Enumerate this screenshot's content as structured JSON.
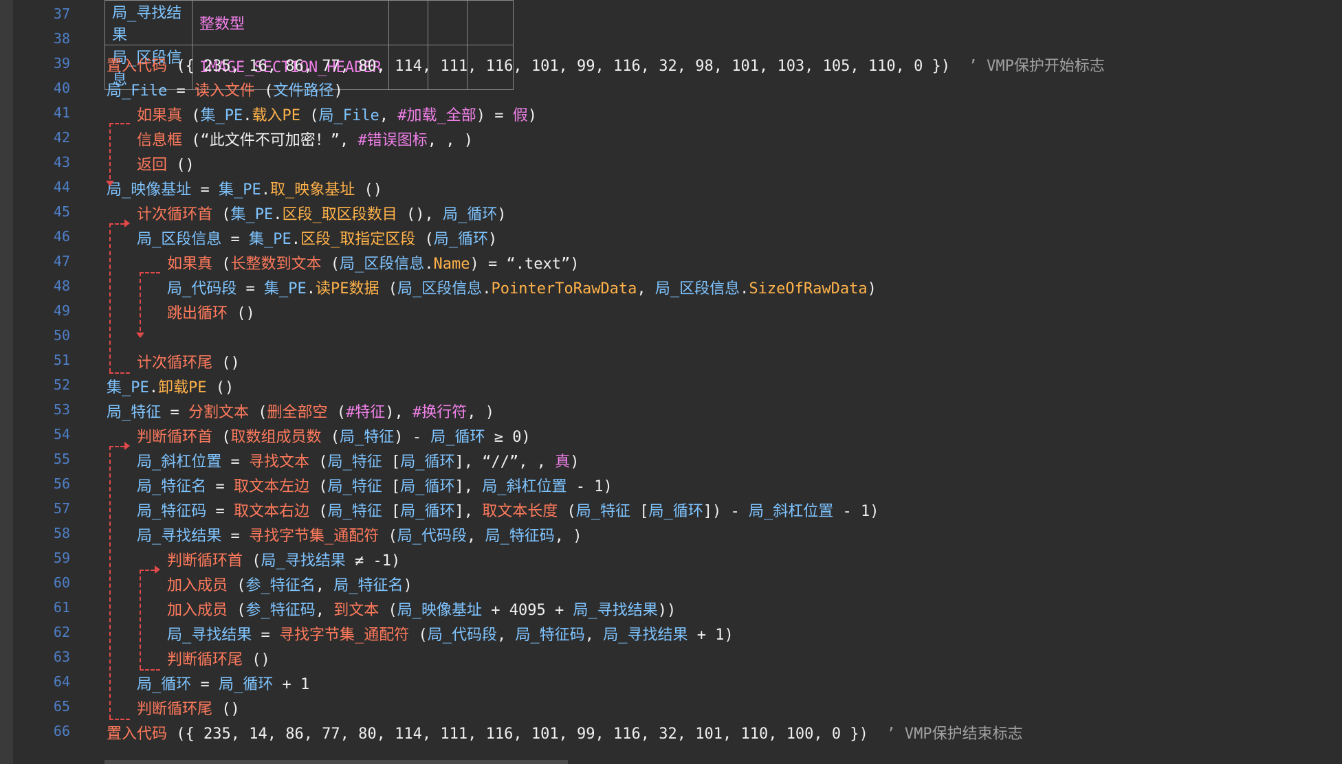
{
  "table": {
    "rows": [
      {
        "name": "局_寻找结果",
        "type": "整数型"
      },
      {
        "name": "局_区段信息",
        "type": "IMAGE_SECTION_HEADER"
      }
    ]
  },
  "lines": [
    {
      "n": "37"
    },
    {
      "n": "38"
    },
    {
      "n": "39",
      "tokens": [
        [
          "t-cmd",
          "置入代码"
        ],
        [
          "t-paren",
          " ({ "
        ],
        [
          "t-num",
          "235, 16, 86, 77, 80, 114, 111, 116, 101, 99, 116, 32, 98, 101, 103, 105, 110, 0"
        ],
        [
          "t-paren",
          " })  "
        ],
        [
          "t-cmt",
          "’ VMP保护开始标志"
        ]
      ]
    },
    {
      "n": "40",
      "tokens": [
        [
          "t-local",
          "局_File"
        ],
        [
          "t-op",
          " = "
        ],
        [
          "t-cmd",
          "读入文件"
        ],
        [
          "t-paren",
          " ("
        ],
        [
          "t-local",
          "文件路径"
        ],
        [
          "t-paren",
          ")"
        ]
      ]
    },
    {
      "n": "41",
      "tokens": [
        [
          "t-flow",
          "如果真"
        ],
        [
          "t-paren",
          " ("
        ],
        [
          "t-glob",
          "集_PE"
        ],
        [
          "t-op",
          "."
        ],
        [
          "t-field",
          "载入PE"
        ],
        [
          "t-paren",
          " ("
        ],
        [
          "t-local",
          "局_File"
        ],
        [
          "t-paren",
          ", "
        ],
        [
          "t-const",
          "#加载_全部"
        ],
        [
          "t-paren",
          ")"
        ],
        [
          "t-op",
          " = "
        ],
        [
          "t-kw",
          "假"
        ],
        [
          "t-paren",
          ")"
        ]
      ]
    },
    {
      "n": "42",
      "tokens": [
        [
          "t-cmd",
          "信息框"
        ],
        [
          "t-paren",
          " ("
        ],
        [
          "t-str",
          "“此文件不可加密！”"
        ],
        [
          "t-paren",
          ", "
        ],
        [
          "t-const",
          "#错误图标"
        ],
        [
          "t-paren",
          ", , )"
        ]
      ]
    },
    {
      "n": "43",
      "tokens": [
        [
          "t-flow",
          "返回"
        ],
        [
          "t-paren",
          " ()"
        ]
      ]
    },
    {
      "n": "44",
      "tokens": [
        [
          "t-local",
          "局_映像基址"
        ],
        [
          "t-op",
          " = "
        ],
        [
          "t-glob",
          "集_PE"
        ],
        [
          "t-op",
          "."
        ],
        [
          "t-field",
          "取_映象基址"
        ],
        [
          "t-paren",
          " ()"
        ]
      ]
    },
    {
      "n": "45",
      "tokens": [
        [
          "t-flow",
          "计次循环首"
        ],
        [
          "t-paren",
          " ("
        ],
        [
          "t-glob",
          "集_PE"
        ],
        [
          "t-op",
          "."
        ],
        [
          "t-field",
          "区段_取区段数目"
        ],
        [
          "t-paren",
          " (), "
        ],
        [
          "t-local",
          "局_循环"
        ],
        [
          "t-paren",
          ")"
        ]
      ]
    },
    {
      "n": "46",
      "tokens": [
        [
          "t-local",
          "局_区段信息"
        ],
        [
          "t-op",
          " = "
        ],
        [
          "t-glob",
          "集_PE"
        ],
        [
          "t-op",
          "."
        ],
        [
          "t-field",
          "区段_取指定区段"
        ],
        [
          "t-paren",
          " ("
        ],
        [
          "t-local",
          "局_循环"
        ],
        [
          "t-paren",
          ")"
        ]
      ]
    },
    {
      "n": "47",
      "tokens": [
        [
          "t-flow",
          "如果真"
        ],
        [
          "t-paren",
          " ("
        ],
        [
          "t-cmd",
          "长整数到文本"
        ],
        [
          "t-paren",
          " ("
        ],
        [
          "t-local",
          "局_区段信息"
        ],
        [
          "t-op",
          "."
        ],
        [
          "t-field",
          "Name"
        ],
        [
          "t-paren",
          ")"
        ],
        [
          "t-op",
          " = "
        ],
        [
          "t-str",
          "“.text”"
        ],
        [
          "t-paren",
          ")"
        ]
      ]
    },
    {
      "n": "48",
      "tokens": [
        [
          "t-local",
          "局_代码段"
        ],
        [
          "t-op",
          " = "
        ],
        [
          "t-glob",
          "集_PE"
        ],
        [
          "t-op",
          "."
        ],
        [
          "t-field",
          "读PE数据"
        ],
        [
          "t-paren",
          " ("
        ],
        [
          "t-local",
          "局_区段信息"
        ],
        [
          "t-op",
          "."
        ],
        [
          "t-field",
          "PointerToRawData"
        ],
        [
          "t-paren",
          ", "
        ],
        [
          "t-local",
          "局_区段信息"
        ],
        [
          "t-op",
          "."
        ],
        [
          "t-field",
          "SizeOfRawData"
        ],
        [
          "t-paren",
          ")"
        ]
      ]
    },
    {
      "n": "49",
      "tokens": [
        [
          "t-flow",
          "跳出循环"
        ],
        [
          "t-paren",
          " ()"
        ]
      ]
    },
    {
      "n": "50"
    },
    {
      "n": "51",
      "tokens": [
        [
          "t-flow",
          "计次循环尾"
        ],
        [
          "t-paren",
          " ()"
        ]
      ]
    },
    {
      "n": "52",
      "tokens": [
        [
          "t-glob",
          "集_PE"
        ],
        [
          "t-op",
          "."
        ],
        [
          "t-field",
          "卸载PE"
        ],
        [
          "t-paren",
          " ()"
        ]
      ]
    },
    {
      "n": "53",
      "tokens": [
        [
          "t-local",
          "局_特征"
        ],
        [
          "t-op",
          " = "
        ],
        [
          "t-cmd",
          "分割文本"
        ],
        [
          "t-paren",
          " ("
        ],
        [
          "t-cmd",
          "删全部空"
        ],
        [
          "t-paren",
          " ("
        ],
        [
          "t-const",
          "#特征"
        ],
        [
          "t-paren",
          "), "
        ],
        [
          "t-const",
          "#换行符"
        ],
        [
          "t-paren",
          ", )"
        ]
      ]
    },
    {
      "n": "54",
      "tokens": [
        [
          "t-flow",
          "判断循环首"
        ],
        [
          "t-paren",
          " ("
        ],
        [
          "t-cmd",
          "取数组成员数"
        ],
        [
          "t-paren",
          " ("
        ],
        [
          "t-local",
          "局_特征"
        ],
        [
          "t-paren",
          ")"
        ],
        [
          "t-op",
          " - "
        ],
        [
          "t-local",
          "局_循环"
        ],
        [
          "t-op",
          " ≥ "
        ],
        [
          "t-num",
          "0"
        ],
        [
          "t-paren",
          ")"
        ]
      ]
    },
    {
      "n": "55",
      "tokens": [
        [
          "t-local",
          "局_斜杠位置"
        ],
        [
          "t-op",
          " = "
        ],
        [
          "t-cmd",
          "寻找文本"
        ],
        [
          "t-paren",
          " ("
        ],
        [
          "t-local",
          "局_特征"
        ],
        [
          "t-paren",
          " ["
        ],
        [
          "t-local",
          "局_循环"
        ],
        [
          "t-paren",
          "], "
        ],
        [
          "t-str",
          "“//”"
        ],
        [
          "t-paren",
          ", , "
        ],
        [
          "t-kw",
          "真"
        ],
        [
          "t-paren",
          ")"
        ]
      ]
    },
    {
      "n": "56",
      "tokens": [
        [
          "t-local",
          "局_特征名"
        ],
        [
          "t-op",
          " = "
        ],
        [
          "t-cmd",
          "取文本左边"
        ],
        [
          "t-paren",
          " ("
        ],
        [
          "t-local",
          "局_特征"
        ],
        [
          "t-paren",
          " ["
        ],
        [
          "t-local",
          "局_循环"
        ],
        [
          "t-paren",
          "], "
        ],
        [
          "t-local",
          "局_斜杠位置"
        ],
        [
          "t-op",
          " - "
        ],
        [
          "t-num",
          "1"
        ],
        [
          "t-paren",
          ")"
        ]
      ]
    },
    {
      "n": "57",
      "tokens": [
        [
          "t-local",
          "局_特征码"
        ],
        [
          "t-op",
          " = "
        ],
        [
          "t-cmd",
          "取文本右边"
        ],
        [
          "t-paren",
          " ("
        ],
        [
          "t-local",
          "局_特征"
        ],
        [
          "t-paren",
          " ["
        ],
        [
          "t-local",
          "局_循环"
        ],
        [
          "t-paren",
          "], "
        ],
        [
          "t-cmd",
          "取文本长度"
        ],
        [
          "t-paren",
          " ("
        ],
        [
          "t-local",
          "局_特征"
        ],
        [
          "t-paren",
          " ["
        ],
        [
          "t-local",
          "局_循环"
        ],
        [
          "t-paren",
          "])"
        ],
        [
          "t-op",
          " - "
        ],
        [
          "t-local",
          "局_斜杠位置"
        ],
        [
          "t-op",
          " - "
        ],
        [
          "t-num",
          "1"
        ],
        [
          "t-paren",
          ")"
        ]
      ]
    },
    {
      "n": "58",
      "tokens": [
        [
          "t-local",
          "局_寻找结果"
        ],
        [
          "t-op",
          " = "
        ],
        [
          "t-cmd",
          "寻找字节集_通配符"
        ],
        [
          "t-paren",
          " ("
        ],
        [
          "t-local",
          "局_代码段"
        ],
        [
          "t-paren",
          ", "
        ],
        [
          "t-local",
          "局_特征码"
        ],
        [
          "t-paren",
          ", )"
        ]
      ]
    },
    {
      "n": "59",
      "tokens": [
        [
          "t-flow",
          "判断循环首"
        ],
        [
          "t-paren",
          " ("
        ],
        [
          "t-local",
          "局_寻找结果"
        ],
        [
          "t-op",
          " ≠ "
        ],
        [
          "t-num",
          "-1"
        ],
        [
          "t-paren",
          ")"
        ]
      ]
    },
    {
      "n": "60",
      "tokens": [
        [
          "t-cmd",
          "加入成员"
        ],
        [
          "t-paren",
          " ("
        ],
        [
          "t-local",
          "参_特征名"
        ],
        [
          "t-paren",
          ", "
        ],
        [
          "t-local",
          "局_特征名"
        ],
        [
          "t-paren",
          ")"
        ]
      ]
    },
    {
      "n": "61",
      "tokens": [
        [
          "t-cmd",
          "加入成员"
        ],
        [
          "t-paren",
          " ("
        ],
        [
          "t-local",
          "参_特征码"
        ],
        [
          "t-paren",
          ", "
        ],
        [
          "t-cmd",
          "到文本"
        ],
        [
          "t-paren",
          " ("
        ],
        [
          "t-local",
          "局_映像基址"
        ],
        [
          "t-op",
          " + "
        ],
        [
          "t-num",
          "4095"
        ],
        [
          "t-op",
          " + "
        ],
        [
          "t-local",
          "局_寻找结果"
        ],
        [
          "t-paren",
          "))"
        ]
      ]
    },
    {
      "n": "62",
      "tokens": [
        [
          "t-local",
          "局_寻找结果"
        ],
        [
          "t-op",
          " = "
        ],
        [
          "t-cmd",
          "寻找字节集_通配符"
        ],
        [
          "t-paren",
          " ("
        ],
        [
          "t-local",
          "局_代码段"
        ],
        [
          "t-paren",
          ", "
        ],
        [
          "t-local",
          "局_特征码"
        ],
        [
          "t-paren",
          ", "
        ],
        [
          "t-local",
          "局_寻找结果"
        ],
        [
          "t-op",
          " + "
        ],
        [
          "t-num",
          "1"
        ],
        [
          "t-paren",
          ")"
        ]
      ]
    },
    {
      "n": "63",
      "tokens": [
        [
          "t-flow",
          "判断循环尾"
        ],
        [
          "t-paren",
          " ()"
        ]
      ]
    },
    {
      "n": "64",
      "tokens": [
        [
          "t-local",
          "局_循环"
        ],
        [
          "t-op",
          " = "
        ],
        [
          "t-local",
          "局_循环"
        ],
        [
          "t-op",
          " + "
        ],
        [
          "t-num",
          "1"
        ]
      ]
    },
    {
      "n": "65",
      "tokens": [
        [
          "t-flow",
          "判断循环尾"
        ],
        [
          "t-paren",
          " ()"
        ]
      ]
    },
    {
      "n": "66",
      "tokens": [
        [
          "t-cmd",
          "置入代码"
        ],
        [
          "t-paren",
          " ({ "
        ],
        [
          "t-num",
          "235, 14, 86, 77, 80, 114, 111, 116, 101, 99, 116, 32, 101, 110, 100, 0"
        ],
        [
          "t-paren",
          " })  "
        ],
        [
          "t-cmt",
          "’ VMP保护结束标志"
        ]
      ]
    }
  ]
}
